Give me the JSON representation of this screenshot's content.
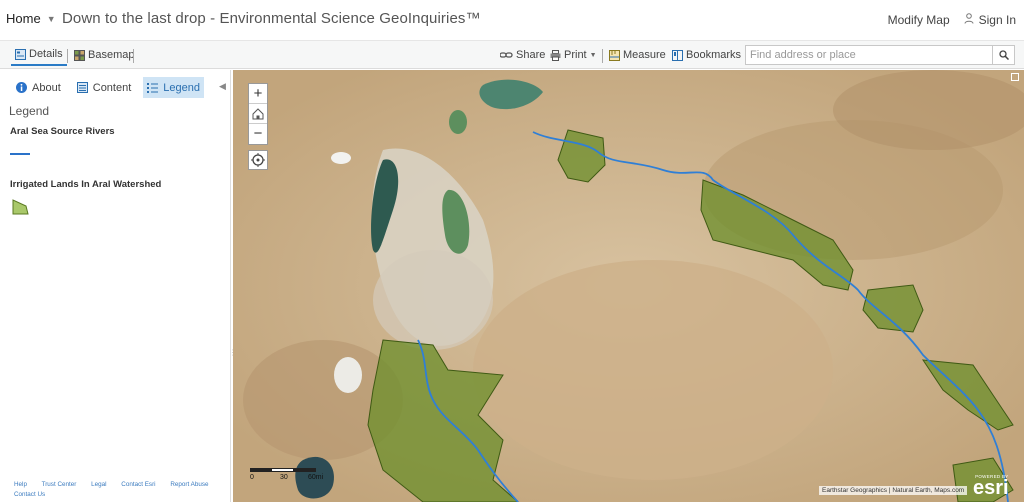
{
  "header": {
    "home_label": "Home",
    "title": "Down to the last drop - Environmental Science GeoInquiries™",
    "modify_map": "Modify Map",
    "sign_in": "Sign In"
  },
  "toolbar": {
    "details": "Details",
    "basemap": "Basemap",
    "share": "Share",
    "print": "Print",
    "measure": "Measure",
    "bookmarks": "Bookmarks",
    "search_placeholder": "Find address or place"
  },
  "panel": {
    "tabs": [
      {
        "label": "About",
        "icon": "info-icon"
      },
      {
        "label": "Content",
        "icon": "content-icon"
      },
      {
        "label": "Legend",
        "icon": "legend-icon",
        "active": true
      }
    ],
    "legend_heading": "Legend",
    "layers": [
      {
        "title": "Aral Sea Source Rivers",
        "symbol": "line",
        "color": "#2a72c9"
      },
      {
        "title": "Irrigated Lands In Aral Watershed",
        "symbol": "polygon",
        "color": "#8fb24a"
      }
    ],
    "footer_links": [
      "Help",
      "Trust Center",
      "Legal",
      "Contact Esri",
      "Report Abuse",
      "Contact Us"
    ]
  },
  "map": {
    "zoom_in": "+",
    "zoom_out": "−",
    "scale_labels": [
      "0",
      "30",
      "60mi"
    ],
    "attribution": "Earthstar Geographics | Natural Earth, Maps.com",
    "esri_powered": "POWERED BY",
    "esri_logo": "esri",
    "colors": {
      "river": "#2f7fd6",
      "irrigated_fill": "#6f8f2e",
      "desert": "#c9ad85"
    }
  }
}
